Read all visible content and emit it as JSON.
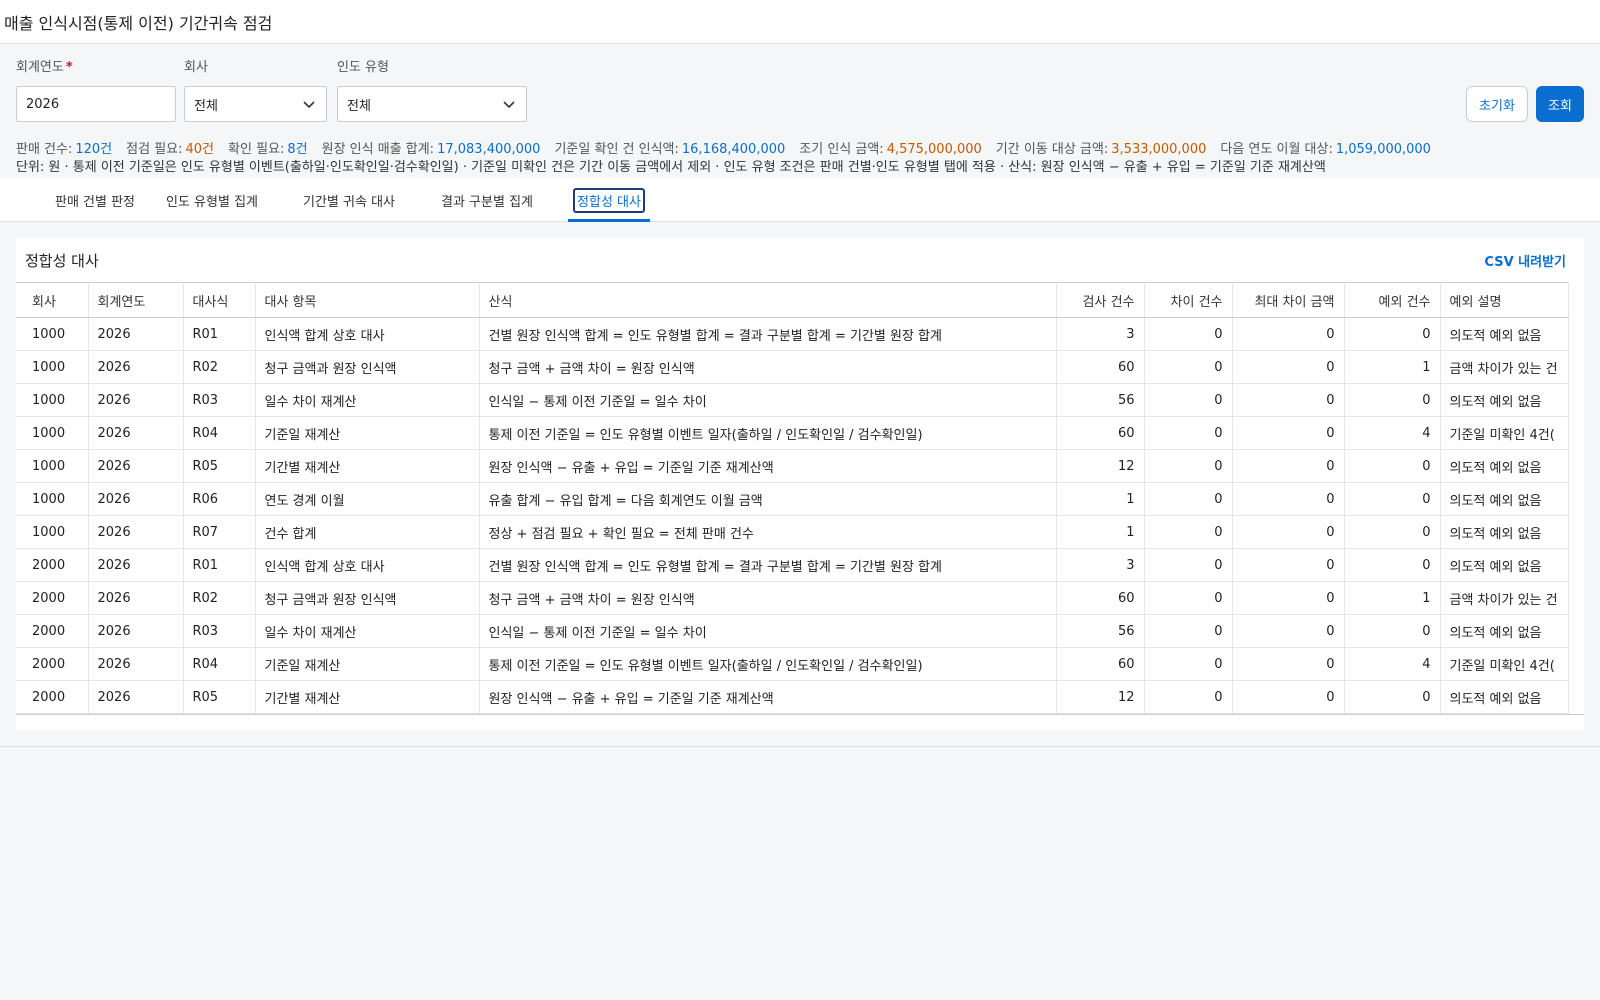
{
  "page": {
    "title": "매출 인식시점(통제 이전) 기간귀속 점검"
  },
  "filters": {
    "year": {
      "label": "회계연도",
      "required_mark": "*",
      "value": "2026"
    },
    "company": {
      "label": "회사",
      "value": "전체"
    },
    "delivery_type": {
      "label": "인도 유형",
      "value": "전체"
    }
  },
  "buttons": {
    "reset": "초기화",
    "search": "조회"
  },
  "summary": {
    "items": [
      {
        "label": "판매 건수:",
        "value": "120건",
        "color": "#0a6ed1"
      },
      {
        "label": "점검 필요:",
        "value": "40건",
        "color": "#c45a00"
      },
      {
        "label": "확인 필요:",
        "value": "8건",
        "color": "#0a6ed1"
      },
      {
        "label": "원장 인식 매출 합계:",
        "value": "17,083,400,000",
        "color": "#0a6ed1"
      },
      {
        "label": "기준일 확인 건 인식액:",
        "value": "16,168,400,000",
        "color": "#0a6ed1"
      },
      {
        "label": "조기 인식 금액:",
        "value": "4,575,000,000",
        "color": "#c45a00"
      },
      {
        "label": "기간 이동 대상 금액:",
        "value": "3,533,000,000",
        "color": "#c45a00"
      },
      {
        "label": "다음 연도 이월 대상:",
        "value": "1,059,000,000",
        "color": "#0a6ed1"
      }
    ],
    "note": "단위: 원 · 통제 이전 기준일은 인도 유형별 이벤트(출하일·인도확인일·검수확인일) · 기준일 미확인 건은 기간 이동 금액에서 제외 · 인도 유형 조건은 판매 건별·인도 유형별 탭에 적용 · 산식: 원장 인식액 − 유출 + 유입 = 기준일 기준 재계산액"
  },
  "tabs": [
    {
      "label": "판매 건별 판정",
      "active": false
    },
    {
      "label": "인도 유형별 집계",
      "active": false
    },
    {
      "label": "기간별 귀속 대사",
      "active": false
    },
    {
      "label": "결과 구분별 집계",
      "active": false
    },
    {
      "label": "정합성 대사",
      "active": true
    }
  ],
  "panel": {
    "title": "정합성 대사",
    "csv_label": "CSV 내려받기",
    "columns": [
      "회사",
      "회계연도",
      "대사식",
      "대사 항목",
      "산식",
      "검사 건수",
      "차이 건수",
      "최대 차이 금액",
      "예외 건수",
      "예외 설명"
    ],
    "rows": [
      [
        "1000",
        "2026",
        "R01",
        "인식액 합계 상호 대사",
        "건별 원장 인식액 합계 = 인도 유형별 합계 = 결과 구분별 합계 = 기간별 원장 합계",
        "3",
        "0",
        "0",
        "0",
        "의도적 예외 없음"
      ],
      [
        "1000",
        "2026",
        "R02",
        "청구 금액과 원장 인식액",
        "청구 금액 + 금액 차이 = 원장 인식액",
        "60",
        "0",
        "0",
        "1",
        "금액 차이가 있는 건"
      ],
      [
        "1000",
        "2026",
        "R03",
        "일수 차이 재계산",
        "인식일 − 통제 이전 기준일 = 일수 차이",
        "56",
        "0",
        "0",
        "0",
        "의도적 예외 없음"
      ],
      [
        "1000",
        "2026",
        "R04",
        "기준일 재계산",
        "통제 이전 기준일 = 인도 유형별 이벤트 일자(출하일 / 인도확인일 / 검수확인일)",
        "60",
        "0",
        "0",
        "4",
        "기준일 미확인 4건("
      ],
      [
        "1000",
        "2026",
        "R05",
        "기간별 재계산",
        "원장 인식액 − 유출 + 유입 = 기준일 기준 재계산액",
        "12",
        "0",
        "0",
        "0",
        "의도적 예외 없음"
      ],
      [
        "1000",
        "2026",
        "R06",
        "연도 경계 이월",
        "유출 합계 − 유입 합계 = 다음 회계연도 이월 금액",
        "1",
        "0",
        "0",
        "0",
        "의도적 예외 없음"
      ],
      [
        "1000",
        "2026",
        "R07",
        "건수 합계",
        "정상 + 점검 필요 + 확인 필요 = 전체 판매 건수",
        "1",
        "0",
        "0",
        "0",
        "의도적 예외 없음"
      ],
      [
        "2000",
        "2026",
        "R01",
        "인식액 합계 상호 대사",
        "건별 원장 인식액 합계 = 인도 유형별 합계 = 결과 구분별 합계 = 기간별 원장 합계",
        "3",
        "0",
        "0",
        "0",
        "의도적 예외 없음"
      ],
      [
        "2000",
        "2026",
        "R02",
        "청구 금액과 원장 인식액",
        "청구 금액 + 금액 차이 = 원장 인식액",
        "60",
        "0",
        "0",
        "1",
        "금액 차이가 있는 건"
      ],
      [
        "2000",
        "2026",
        "R03",
        "일수 차이 재계산",
        "인식일 − 통제 이전 기준일 = 일수 차이",
        "56",
        "0",
        "0",
        "0",
        "의도적 예외 없음"
      ],
      [
        "2000",
        "2026",
        "R04",
        "기준일 재계산",
        "통제 이전 기준일 = 인도 유형별 이벤트 일자(출하일 / 인도확인일 / 검수확인일)",
        "60",
        "0",
        "0",
        "4",
        "기준일 미확인 4건("
      ],
      [
        "2000",
        "2026",
        "R05",
        "기간별 재계산",
        "원장 인식액 − 유출 + 유입 = 기준일 기준 재계산액",
        "12",
        "0",
        "0",
        "0",
        "의도적 예외 없음"
      ]
    ]
  },
  "colors": {
    "accent": "#0a6ed1",
    "warning": "#c45a00",
    "required": "#c8102e"
  }
}
